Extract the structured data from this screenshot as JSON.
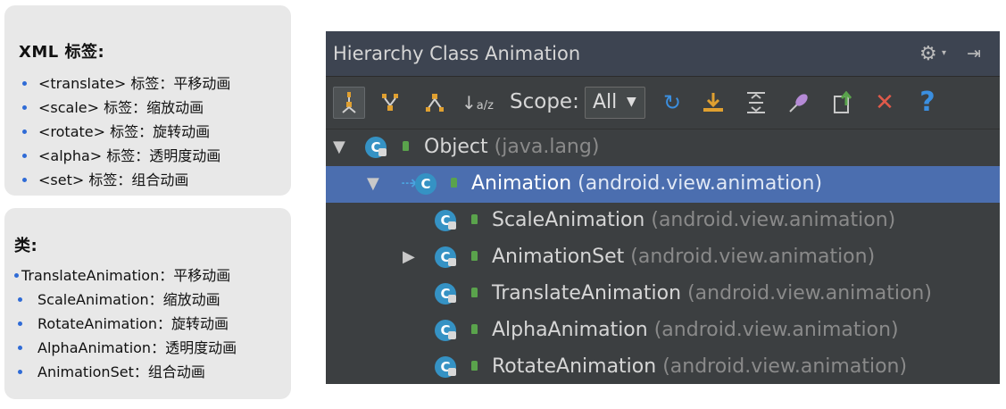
{
  "xml_card": {
    "title": "XML 标签:",
    "items": [
      "<translate> 标签：平移动画",
      "<scale> 标签：缩放动画",
      "<rotate> 标签：旋转动画",
      "<alpha> 标签：透明度动画",
      "<set> 标签：组合动画"
    ]
  },
  "class_card": {
    "title": "类:",
    "items": [
      "TranslateAnimation：平移动画",
      "ScaleAnimation：缩放动画",
      "RotateAnimation：旋转动画",
      "AlphaAnimation：透明度动画",
      "AnimationSet：组合动画"
    ]
  },
  "ide": {
    "title": "Hierarchy Class Animation",
    "scope_label": "Scope:",
    "scope_value": "All",
    "tree": [
      {
        "name": "Object",
        "package": "(java.lang)"
      },
      {
        "name": "Animation",
        "package": "(android.view.animation)"
      },
      {
        "name": "ScaleAnimation",
        "package": "(android.view.animation)"
      },
      {
        "name": "AnimationSet",
        "package": "(android.view.animation)"
      },
      {
        "name": "TranslateAnimation",
        "package": "(android.view.animation)"
      },
      {
        "name": "AlphaAnimation",
        "package": "(android.view.animation)"
      },
      {
        "name": "RotateAnimation",
        "package": "(android.view.animation)"
      }
    ],
    "icons": {
      "class_icon_letter": "C"
    },
    "colors": {
      "selection": "#4b6eaf",
      "class_icon": "#3592c4",
      "close_red": "#e05a4a",
      "help_blue": "#3b8fe0"
    }
  }
}
